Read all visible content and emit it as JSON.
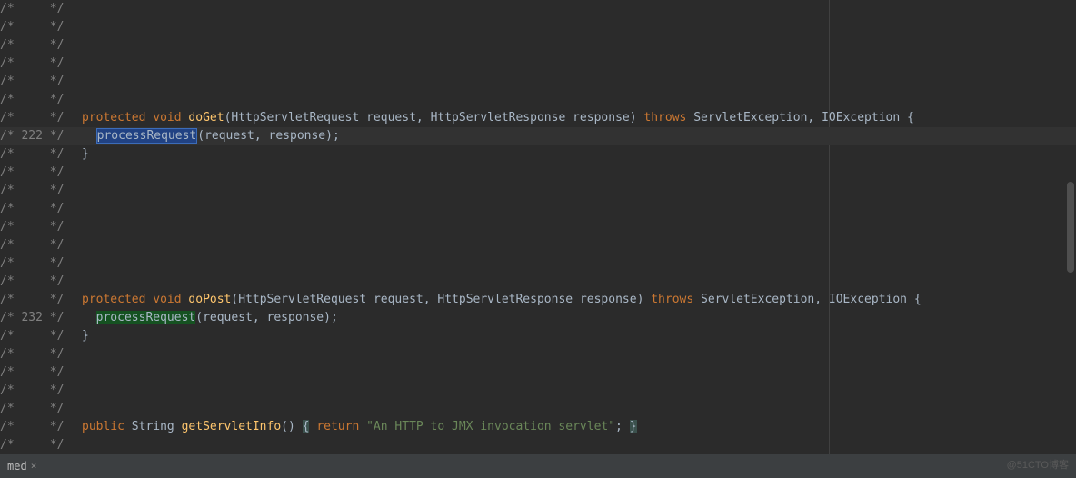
{
  "editor": {
    "lines": [
      {
        "gutter": "/*     */",
        "tokens": []
      },
      {
        "gutter": "/*     */",
        "tokens": []
      },
      {
        "gutter": "/*     */",
        "tokens": []
      },
      {
        "gutter": "/*     */",
        "tokens": []
      },
      {
        "gutter": "/*     */",
        "tokens": []
      },
      {
        "gutter": "/*     */",
        "tokens": []
      },
      {
        "gutter": "/*     */",
        "tokens": [
          {
            "t": "kw",
            "v": "protected"
          },
          {
            "t": "sp",
            "v": " "
          },
          {
            "t": "kw",
            "v": "void"
          },
          {
            "t": "sp",
            "v": " "
          },
          {
            "t": "method-decl",
            "v": "doGet"
          },
          {
            "t": "punct",
            "v": "("
          },
          {
            "t": "type",
            "v": "HttpServletRequest"
          },
          {
            "t": "sp",
            "v": " "
          },
          {
            "t": "param",
            "v": "request"
          },
          {
            "t": "punct",
            "v": ","
          },
          {
            "t": "sp",
            "v": " "
          },
          {
            "t": "type",
            "v": "HttpServletResponse"
          },
          {
            "t": "sp",
            "v": " "
          },
          {
            "t": "param",
            "v": "response"
          },
          {
            "t": "punct",
            "v": ")"
          },
          {
            "t": "sp",
            "v": " "
          },
          {
            "t": "kw",
            "v": "throws"
          },
          {
            "t": "sp",
            "v": " "
          },
          {
            "t": "type",
            "v": "ServletException"
          },
          {
            "t": "punct",
            "v": ","
          },
          {
            "t": "sp",
            "v": " "
          },
          {
            "t": "type",
            "v": "IOException"
          },
          {
            "t": "sp",
            "v": " "
          },
          {
            "t": "punct",
            "v": "{"
          }
        ]
      },
      {
        "gutter": "/* 222 */",
        "hl": true,
        "tokens": [
          {
            "t": "sp",
            "v": "  "
          },
          {
            "t": "call-hl-blue",
            "v": "processRequest"
          },
          {
            "t": "punct",
            "v": "("
          },
          {
            "t": "param",
            "v": "request"
          },
          {
            "t": "punct",
            "v": ","
          },
          {
            "t": "sp",
            "v": " "
          },
          {
            "t": "param",
            "v": "response"
          },
          {
            "t": "punct",
            "v": ");"
          }
        ]
      },
      {
        "gutter": "/*     */",
        "tokens": [
          {
            "t": "punct",
            "v": "}"
          }
        ]
      },
      {
        "gutter": "/*     */",
        "tokens": []
      },
      {
        "gutter": "/*     */",
        "tokens": []
      },
      {
        "gutter": "/*     */",
        "tokens": []
      },
      {
        "gutter": "/*     */",
        "tokens": []
      },
      {
        "gutter": "/*     */",
        "tokens": []
      },
      {
        "gutter": "/*     */",
        "tokens": []
      },
      {
        "gutter": "/*     */",
        "tokens": []
      },
      {
        "gutter": "/*     */",
        "tokens": [
          {
            "t": "kw",
            "v": "protected"
          },
          {
            "t": "sp",
            "v": " "
          },
          {
            "t": "kw",
            "v": "void"
          },
          {
            "t": "sp",
            "v": " "
          },
          {
            "t": "method-decl",
            "v": "doPost"
          },
          {
            "t": "punct",
            "v": "("
          },
          {
            "t": "type",
            "v": "HttpServletRequest"
          },
          {
            "t": "sp",
            "v": " "
          },
          {
            "t": "param",
            "v": "request"
          },
          {
            "t": "punct",
            "v": ","
          },
          {
            "t": "sp",
            "v": " "
          },
          {
            "t": "type",
            "v": "HttpServletResponse"
          },
          {
            "t": "sp",
            "v": " "
          },
          {
            "t": "param",
            "v": "response"
          },
          {
            "t": "punct",
            "v": ")"
          },
          {
            "t": "sp",
            "v": " "
          },
          {
            "t": "kw",
            "v": "throws"
          },
          {
            "t": "sp",
            "v": " "
          },
          {
            "t": "type",
            "v": "ServletException"
          },
          {
            "t": "punct",
            "v": ","
          },
          {
            "t": "sp",
            "v": " "
          },
          {
            "t": "type",
            "v": "IOException"
          },
          {
            "t": "sp",
            "v": " "
          },
          {
            "t": "punct",
            "v": "{"
          }
        ]
      },
      {
        "gutter": "/* 232 */",
        "tokens": [
          {
            "t": "sp",
            "v": "  "
          },
          {
            "t": "call-hl-green",
            "v": "processRequest"
          },
          {
            "t": "punct",
            "v": "("
          },
          {
            "t": "param",
            "v": "request"
          },
          {
            "t": "punct",
            "v": ","
          },
          {
            "t": "sp",
            "v": " "
          },
          {
            "t": "param",
            "v": "response"
          },
          {
            "t": "punct",
            "v": ");"
          }
        ]
      },
      {
        "gutter": "/*     */",
        "tokens": [
          {
            "t": "punct",
            "v": "}"
          }
        ]
      },
      {
        "gutter": "/*     */",
        "tokens": []
      },
      {
        "gutter": "/*     */",
        "tokens": []
      },
      {
        "gutter": "/*     */",
        "tokens": []
      },
      {
        "gutter": "/*     */",
        "tokens": []
      },
      {
        "gutter": "/*     */",
        "tokens": [
          {
            "t": "kw",
            "v": "public"
          },
          {
            "t": "sp",
            "v": " "
          },
          {
            "t": "type",
            "v": "String"
          },
          {
            "t": "sp",
            "v": " "
          },
          {
            "t": "method-decl",
            "v": "getServletInfo"
          },
          {
            "t": "punct",
            "v": "()"
          },
          {
            "t": "sp",
            "v": " "
          },
          {
            "t": "brace-hl",
            "v": "{"
          },
          {
            "t": "sp",
            "v": " "
          },
          {
            "t": "kw",
            "v": "return"
          },
          {
            "t": "sp",
            "v": " "
          },
          {
            "t": "string",
            "v": "\"An HTTP to JMX invocation servlet\""
          },
          {
            "t": "punct",
            "v": ";"
          },
          {
            "t": "sp",
            "v": " "
          },
          {
            "t": "brace-hl",
            "v": "}"
          }
        ]
      },
      {
        "gutter": "/*     */",
        "tokens": []
      }
    ]
  },
  "bottomBar": {
    "tabLabel": "med",
    "closeGlyph": "×"
  },
  "watermark": "@51CTO博客"
}
